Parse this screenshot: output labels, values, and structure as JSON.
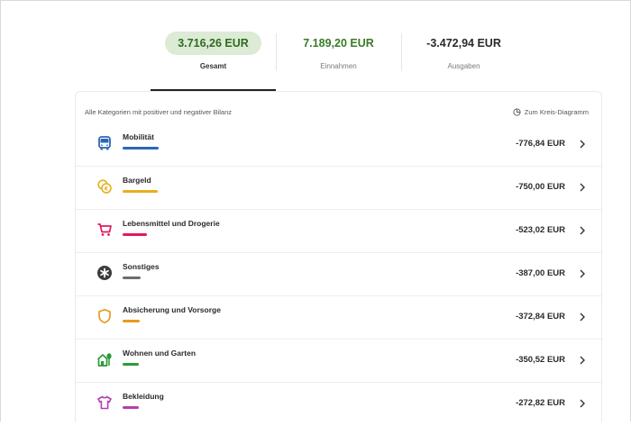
{
  "tabs": [
    {
      "amount": "3.716,26 EUR",
      "label": "Gesamt"
    },
    {
      "amount": "7.189,20 EUR",
      "label": "Einnahmen"
    },
    {
      "amount": "-3.472,94 EUR",
      "label": "Ausgaben"
    }
  ],
  "panel": {
    "heading": "Alle Kategorien mit positiver und negativer Bilanz",
    "pie_link": "Zum Kreis-Diagramm",
    "pie_icon": "pie-chart-icon"
  },
  "categories": [
    {
      "name": "Mobilität",
      "amount": "-776,84 EUR",
      "icon": "bus-icon",
      "color": "#2b67b8",
      "bar_fraction": 1.0
    },
    {
      "name": "Bargeld",
      "amount": "-750,00 EUR",
      "icon": "coins-icon",
      "color": "#e5b01b",
      "bar_fraction": 0.965
    },
    {
      "name": "Lebensmittel und Drogerie",
      "amount": "-523,02 EUR",
      "icon": "cart-icon",
      "color": "#e4195a",
      "bar_fraction": 0.673
    },
    {
      "name": "Sonstiges",
      "amount": "-387,00 EUR",
      "icon": "asterisk-icon",
      "color": "#6e6e6e",
      "bar_fraction": 0.498
    },
    {
      "name": "Absicherung und Vorsorge",
      "amount": "-372,84 EUR",
      "icon": "shield-icon",
      "color": "#e79b1f",
      "bar_fraction": 0.48
    },
    {
      "name": "Wohnen und Garten",
      "amount": "-350,52 EUR",
      "icon": "house-plant-icon",
      "color": "#2c9a3a",
      "bar_fraction": 0.451
    },
    {
      "name": "Bekleidung",
      "amount": "-272,82 EUR",
      "icon": "shirt-icon",
      "color": "#b33fae",
      "bar_fraction": 0.351
    }
  ]
}
